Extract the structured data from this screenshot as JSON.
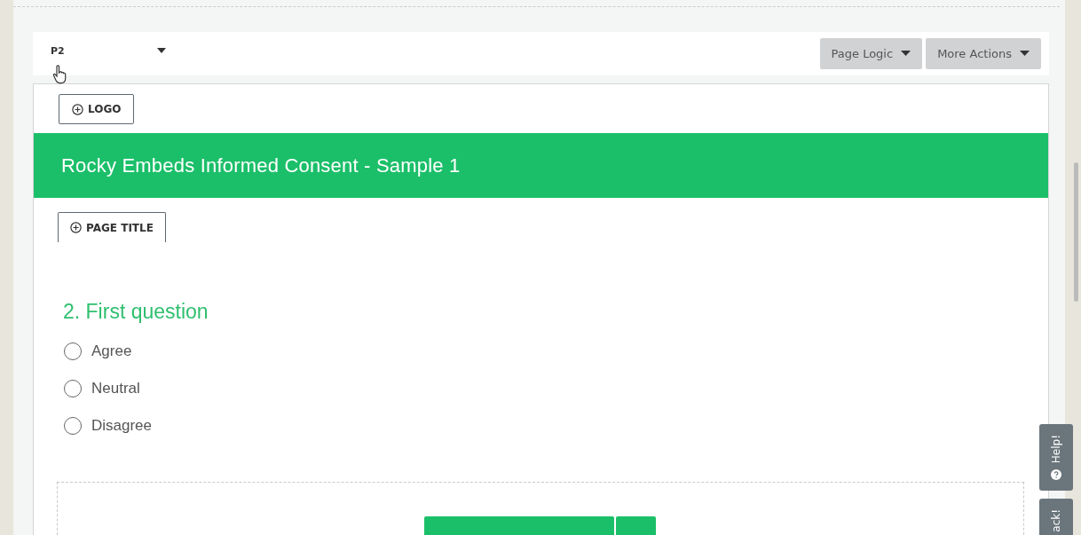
{
  "page_selector": {
    "value": "P2"
  },
  "header_buttons": [
    {
      "label": "Page Logic"
    },
    {
      "label": "More Actions"
    }
  ],
  "logo_button": {
    "label": "LOGO"
  },
  "survey_title": "Rocky Embeds Informed Consent - Sample 1",
  "page_title_button": {
    "label": "PAGE TITLE"
  },
  "question": {
    "title": "2. First question",
    "options": [
      {
        "label": "Agree",
        "selected": false
      },
      {
        "label": "Neutral",
        "selected": false
      },
      {
        "label": "Disagree",
        "selected": false
      }
    ]
  },
  "side_tabs": [
    {
      "label": "Help!",
      "kind": "help"
    },
    {
      "label": "ack!",
      "kind": "plain"
    }
  ]
}
